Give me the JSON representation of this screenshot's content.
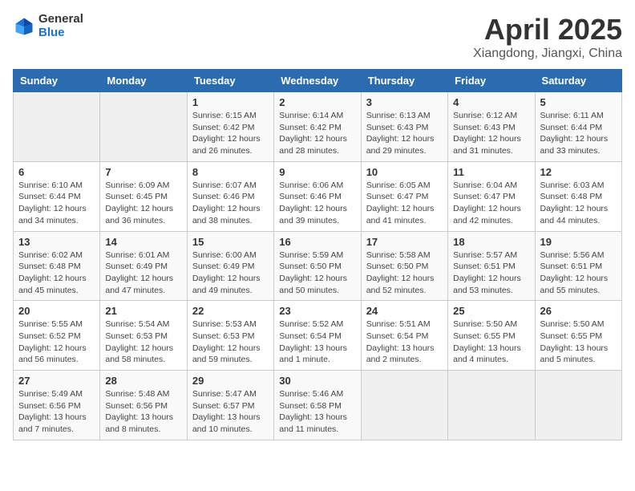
{
  "logo": {
    "general": "General",
    "blue": "Blue"
  },
  "header": {
    "month": "April 2025",
    "location": "Xiangdong, Jiangxi, China"
  },
  "weekdays": [
    "Sunday",
    "Monday",
    "Tuesday",
    "Wednesday",
    "Thursday",
    "Friday",
    "Saturday"
  ],
  "weeks": [
    [
      null,
      null,
      {
        "day": "1",
        "sunrise": "Sunrise: 6:15 AM",
        "sunset": "Sunset: 6:42 PM",
        "daylight": "Daylight: 12 hours and 26 minutes."
      },
      {
        "day": "2",
        "sunrise": "Sunrise: 6:14 AM",
        "sunset": "Sunset: 6:42 PM",
        "daylight": "Daylight: 12 hours and 28 minutes."
      },
      {
        "day": "3",
        "sunrise": "Sunrise: 6:13 AM",
        "sunset": "Sunset: 6:43 PM",
        "daylight": "Daylight: 12 hours and 29 minutes."
      },
      {
        "day": "4",
        "sunrise": "Sunrise: 6:12 AM",
        "sunset": "Sunset: 6:43 PM",
        "daylight": "Daylight: 12 hours and 31 minutes."
      },
      {
        "day": "5",
        "sunrise": "Sunrise: 6:11 AM",
        "sunset": "Sunset: 6:44 PM",
        "daylight": "Daylight: 12 hours and 33 minutes."
      }
    ],
    [
      {
        "day": "6",
        "sunrise": "Sunrise: 6:10 AM",
        "sunset": "Sunset: 6:44 PM",
        "daylight": "Daylight: 12 hours and 34 minutes."
      },
      {
        "day": "7",
        "sunrise": "Sunrise: 6:09 AM",
        "sunset": "Sunset: 6:45 PM",
        "daylight": "Daylight: 12 hours and 36 minutes."
      },
      {
        "day": "8",
        "sunrise": "Sunrise: 6:07 AM",
        "sunset": "Sunset: 6:46 PM",
        "daylight": "Daylight: 12 hours and 38 minutes."
      },
      {
        "day": "9",
        "sunrise": "Sunrise: 6:06 AM",
        "sunset": "Sunset: 6:46 PM",
        "daylight": "Daylight: 12 hours and 39 minutes."
      },
      {
        "day": "10",
        "sunrise": "Sunrise: 6:05 AM",
        "sunset": "Sunset: 6:47 PM",
        "daylight": "Daylight: 12 hours and 41 minutes."
      },
      {
        "day": "11",
        "sunrise": "Sunrise: 6:04 AM",
        "sunset": "Sunset: 6:47 PM",
        "daylight": "Daylight: 12 hours and 42 minutes."
      },
      {
        "day": "12",
        "sunrise": "Sunrise: 6:03 AM",
        "sunset": "Sunset: 6:48 PM",
        "daylight": "Daylight: 12 hours and 44 minutes."
      }
    ],
    [
      {
        "day": "13",
        "sunrise": "Sunrise: 6:02 AM",
        "sunset": "Sunset: 6:48 PM",
        "daylight": "Daylight: 12 hours and 45 minutes."
      },
      {
        "day": "14",
        "sunrise": "Sunrise: 6:01 AM",
        "sunset": "Sunset: 6:49 PM",
        "daylight": "Daylight: 12 hours and 47 minutes."
      },
      {
        "day": "15",
        "sunrise": "Sunrise: 6:00 AM",
        "sunset": "Sunset: 6:49 PM",
        "daylight": "Daylight: 12 hours and 49 minutes."
      },
      {
        "day": "16",
        "sunrise": "Sunrise: 5:59 AM",
        "sunset": "Sunset: 6:50 PM",
        "daylight": "Daylight: 12 hours and 50 minutes."
      },
      {
        "day": "17",
        "sunrise": "Sunrise: 5:58 AM",
        "sunset": "Sunset: 6:50 PM",
        "daylight": "Daylight: 12 hours and 52 minutes."
      },
      {
        "day": "18",
        "sunrise": "Sunrise: 5:57 AM",
        "sunset": "Sunset: 6:51 PM",
        "daylight": "Daylight: 12 hours and 53 minutes."
      },
      {
        "day": "19",
        "sunrise": "Sunrise: 5:56 AM",
        "sunset": "Sunset: 6:51 PM",
        "daylight": "Daylight: 12 hours and 55 minutes."
      }
    ],
    [
      {
        "day": "20",
        "sunrise": "Sunrise: 5:55 AM",
        "sunset": "Sunset: 6:52 PM",
        "daylight": "Daylight: 12 hours and 56 minutes."
      },
      {
        "day": "21",
        "sunrise": "Sunrise: 5:54 AM",
        "sunset": "Sunset: 6:53 PM",
        "daylight": "Daylight: 12 hours and 58 minutes."
      },
      {
        "day": "22",
        "sunrise": "Sunrise: 5:53 AM",
        "sunset": "Sunset: 6:53 PM",
        "daylight": "Daylight: 12 hours and 59 minutes."
      },
      {
        "day": "23",
        "sunrise": "Sunrise: 5:52 AM",
        "sunset": "Sunset: 6:54 PM",
        "daylight": "Daylight: 13 hours and 1 minute."
      },
      {
        "day": "24",
        "sunrise": "Sunrise: 5:51 AM",
        "sunset": "Sunset: 6:54 PM",
        "daylight": "Daylight: 13 hours and 2 minutes."
      },
      {
        "day": "25",
        "sunrise": "Sunrise: 5:50 AM",
        "sunset": "Sunset: 6:55 PM",
        "daylight": "Daylight: 13 hours and 4 minutes."
      },
      {
        "day": "26",
        "sunrise": "Sunrise: 5:50 AM",
        "sunset": "Sunset: 6:55 PM",
        "daylight": "Daylight: 13 hours and 5 minutes."
      }
    ],
    [
      {
        "day": "27",
        "sunrise": "Sunrise: 5:49 AM",
        "sunset": "Sunset: 6:56 PM",
        "daylight": "Daylight: 13 hours and 7 minutes."
      },
      {
        "day": "28",
        "sunrise": "Sunrise: 5:48 AM",
        "sunset": "Sunset: 6:56 PM",
        "daylight": "Daylight: 13 hours and 8 minutes."
      },
      {
        "day": "29",
        "sunrise": "Sunrise: 5:47 AM",
        "sunset": "Sunset: 6:57 PM",
        "daylight": "Daylight: 13 hours and 10 minutes."
      },
      {
        "day": "30",
        "sunrise": "Sunrise: 5:46 AM",
        "sunset": "Sunset: 6:58 PM",
        "daylight": "Daylight: 13 hours and 11 minutes."
      },
      null,
      null,
      null
    ]
  ]
}
